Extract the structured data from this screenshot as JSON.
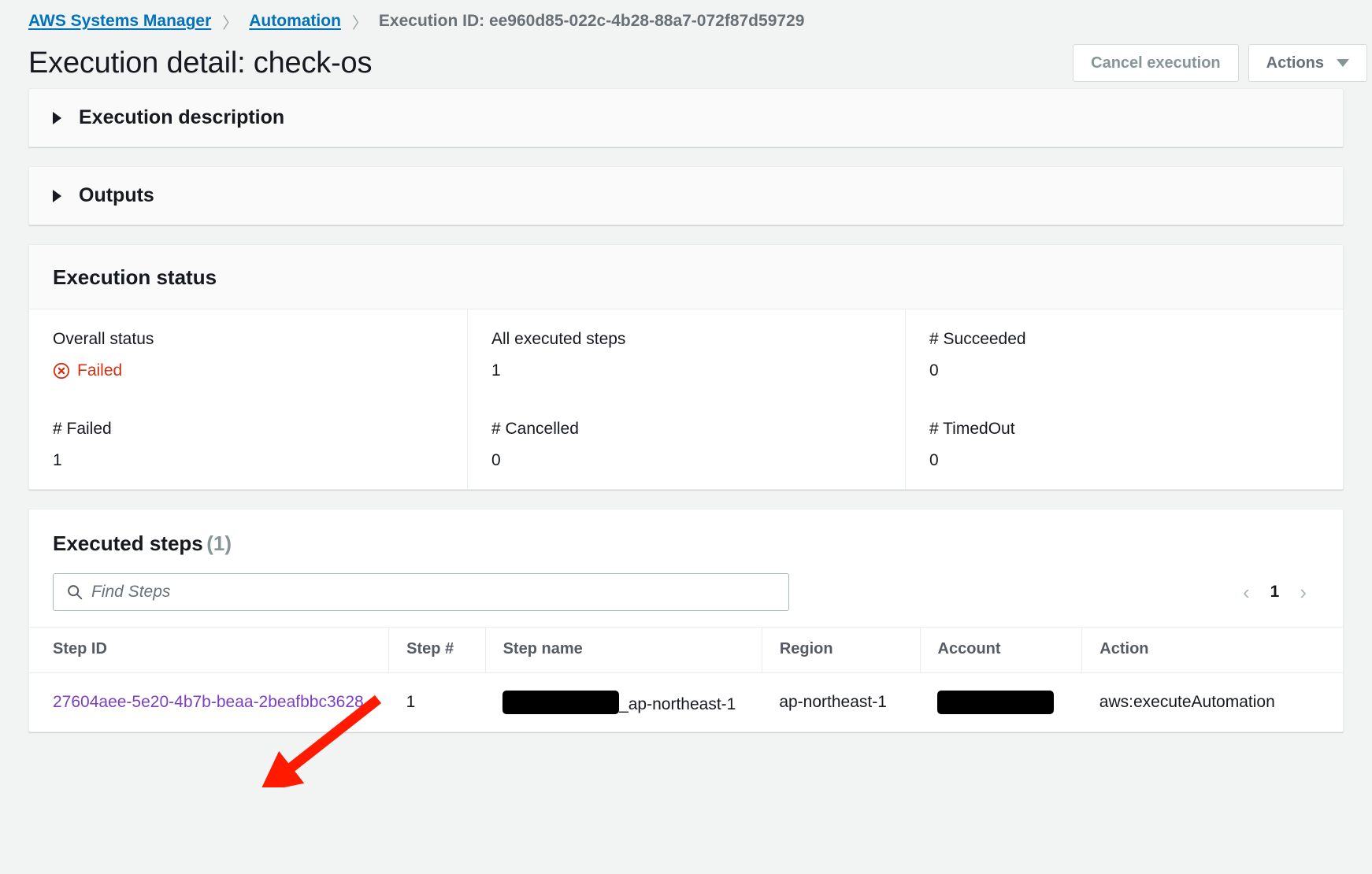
{
  "breadcrumb": {
    "service": "AWS Systems Manager",
    "section": "Automation",
    "current": "Execution ID: ee960d85-022c-4b28-88a7-072f87d59729",
    "separator": "〉"
  },
  "header": {
    "title": "Execution detail: check-os",
    "cancel_label": "Cancel execution",
    "actions_label": "Actions"
  },
  "sections": {
    "execution_description": "Execution description",
    "outputs": "Outputs"
  },
  "execution_status": {
    "title": "Execution status",
    "cells": [
      {
        "label": "Overall status",
        "value": "Failed",
        "status": "failed"
      },
      {
        "label": "All executed steps",
        "value": "1"
      },
      {
        "label": "# Succeeded",
        "value": "0"
      },
      {
        "label": "# Failed",
        "value": "1"
      },
      {
        "label": "# Cancelled",
        "value": "0"
      },
      {
        "label": "# TimedOut",
        "value": "0"
      }
    ],
    "failed_color": "#d13212"
  },
  "executed_steps": {
    "title": "Executed steps",
    "count": "(1)",
    "search": {
      "placeholder": "Find Steps",
      "value": ""
    },
    "pagination": {
      "prev": "‹",
      "page": "1",
      "next": "›"
    },
    "columns": [
      "Step ID",
      "Step #",
      "Step name",
      "Region",
      "Account",
      "Action"
    ],
    "rows": [
      {
        "step_id": "27604aee-5e20-4b7b-beaa-2beafbbc3628",
        "step_number": "1",
        "step_name_redacted": true,
        "step_name_suffix": "_ap-northeast-1",
        "region": "ap-northeast-1",
        "account_redacted": true,
        "action": "aws:executeAutomation"
      }
    ]
  },
  "annotation": {
    "arrow_color": "#ff1a00"
  },
  "colors": {
    "link": "#0073bb",
    "visited_link": "#7b3fbf",
    "error": "#d13212",
    "page_bg": "#f2f3f3"
  }
}
